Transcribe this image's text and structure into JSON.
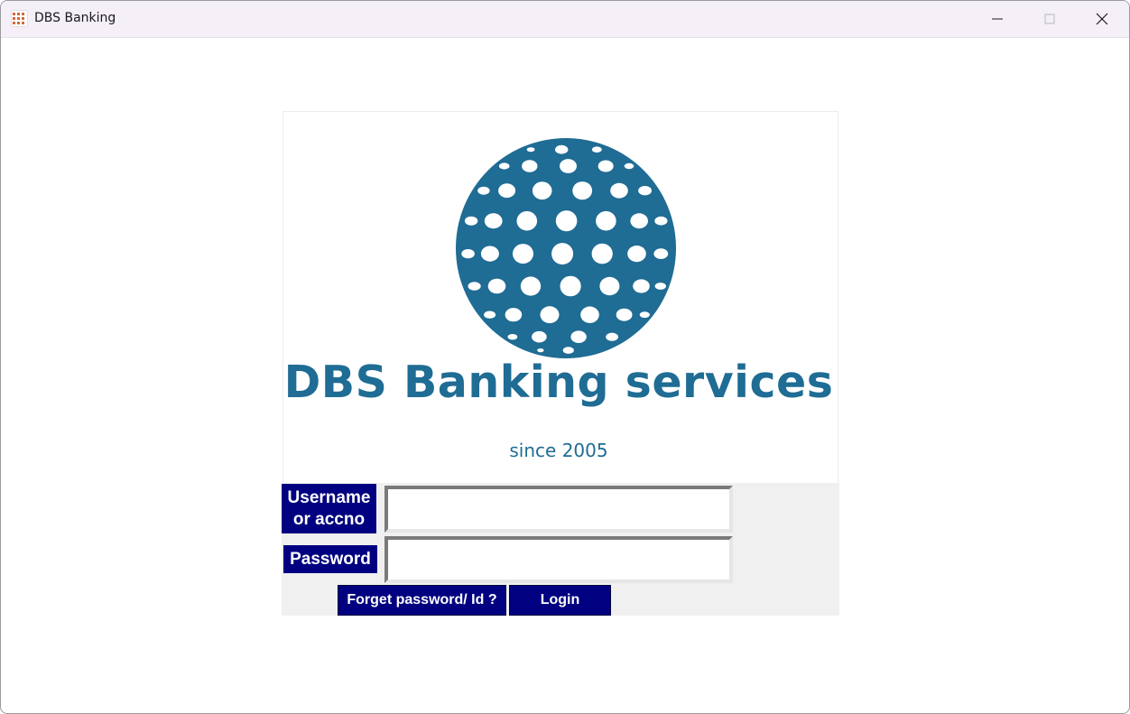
{
  "window": {
    "title": "DBS Banking",
    "icon": "app-grid-icon",
    "controls": [
      "minimize-icon",
      "maximize-icon",
      "close-icon"
    ]
  },
  "logo": {
    "brand": "DBS Banking services",
    "tagline": "since 2005",
    "icon": "globe-icon"
  },
  "form": {
    "username_label": "Username or accno",
    "username_value": "",
    "password_label": "Password",
    "password_value": "",
    "forgot_button": "Forget password/ Id ?",
    "login_button": "Login"
  },
  "colors": {
    "accent": "#000080",
    "brand": "#1f6c94",
    "titlebar": "#f5eff8",
    "form_background": "#f0f0f0"
  }
}
